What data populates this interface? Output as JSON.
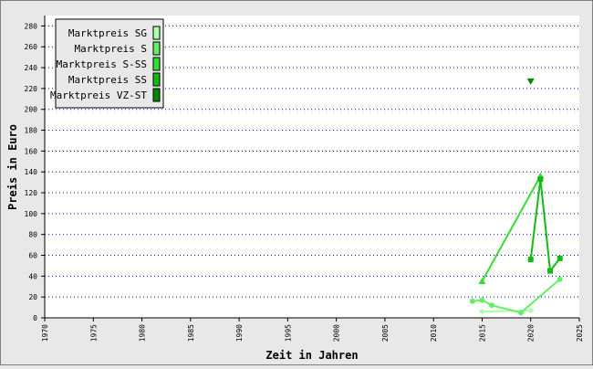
{
  "chart_data": {
    "type": "line",
    "xlabel": "Zeit in Jahren",
    "ylabel": "Preis in Euro",
    "xlim": [
      1970,
      2025
    ],
    "ylim": [
      0,
      290
    ],
    "x_ticks": [
      "1970",
      "1975",
      "1980",
      "1985",
      "1990",
      "1995",
      "2000",
      "2005",
      "2010",
      "2015",
      "2020",
      "2025"
    ],
    "y_ticks": [
      "0",
      "20",
      "40",
      "60",
      "80",
      "100",
      "120",
      "140",
      "160",
      "180",
      "200",
      "220",
      "240",
      "260",
      "280"
    ],
    "grid": "horizontal dotted",
    "legend": "top-left",
    "series": [
      {
        "name": "Marktpreis SG",
        "color": "#aaffaa",
        "marker": "diamond",
        "points": [
          [
            2015,
            6
          ],
          [
            2020,
            7
          ]
        ]
      },
      {
        "name": "Marktpreis S",
        "color": "#66ee66",
        "marker": "circle",
        "points": [
          [
            2014,
            16
          ],
          [
            2015,
            17
          ],
          [
            2016,
            12
          ],
          [
            2019,
            5
          ],
          [
            2023,
            37
          ]
        ]
      },
      {
        "name": "Marktpreis S-SS",
        "color": "#33dd33",
        "marker": "triangle-up",
        "points": [
          [
            2015,
            35
          ],
          [
            2021,
            136
          ]
        ]
      },
      {
        "name": "Marktpreis SS",
        "color": "#11bb11",
        "marker": "square",
        "points": [
          [
            2020,
            56
          ],
          [
            2021,
            133
          ],
          [
            2022,
            45
          ],
          [
            2023,
            57
          ]
        ]
      },
      {
        "name": "Marktpreis VZ-ST",
        "color": "#008800",
        "marker": "triangle-down",
        "points": [
          [
            2020,
            227
          ]
        ]
      }
    ]
  }
}
